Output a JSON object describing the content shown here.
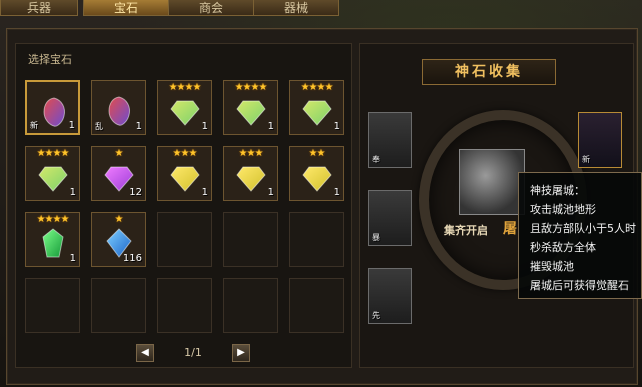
{
  "tabs": [
    {
      "label": "兵器",
      "active": false
    },
    {
      "label": "宝石",
      "active": true
    },
    {
      "label": "商会",
      "active": false
    },
    {
      "label": "器械",
      "active": false
    }
  ],
  "gems_panel": {
    "title": "选择宝石",
    "items": [
      {
        "stars": "",
        "count": "1",
        "tag": "新",
        "kind": "rainbow"
      },
      {
        "stars": "",
        "count": "1",
        "tag": "乱",
        "kind": "rainbow"
      },
      {
        "stars": "★★★★",
        "count": "1",
        "tag": "",
        "kind": "green-yellow"
      },
      {
        "stars": "★★★★",
        "count": "1",
        "tag": "",
        "kind": "green-yellow"
      },
      {
        "stars": "★★★★",
        "count": "1",
        "tag": "",
        "kind": "green-yellow"
      },
      {
        "stars": "★★★★",
        "count": "1",
        "tag": "",
        "kind": "green-yellow"
      },
      {
        "stars": "★",
        "count": "12",
        "tag": "",
        "kind": "purple-crystal"
      },
      {
        "stars": "★★★",
        "count": "1",
        "tag": "",
        "kind": "yellow-crystal"
      },
      {
        "stars": "★★★",
        "count": "1",
        "tag": "",
        "kind": "yellow-crystal"
      },
      {
        "stars": "★★",
        "count": "1",
        "tag": "",
        "kind": "yellow-crystal"
      },
      {
        "stars": "★★★★",
        "count": "1",
        "tag": "",
        "kind": "green-emerald"
      },
      {
        "stars": "★",
        "count": "116",
        "tag": "",
        "kind": "blue-diamond"
      }
    ],
    "pager": {
      "text": "1/1",
      "prev": "◀",
      "next": "▶"
    }
  },
  "collection": {
    "title": "神石收集",
    "slots": [
      {
        "tag": "奉",
        "style": "gray"
      },
      {
        "tag": "暴",
        "style": "gray"
      },
      {
        "tag": "先",
        "style": "gray"
      },
      {
        "tag": "新",
        "style": "gold"
      }
    ],
    "hero_label": "集齐开启",
    "hero_label_suffix": "屠"
  },
  "tooltip": {
    "lines": [
      "神技屠城：",
      "攻击城池地形",
      "且敌方部队小于5人时",
      "秒杀敌方全体",
      "摧毁城池",
      "屠城后可获得觉醒石"
    ]
  },
  "colors": {
    "gold": "#c89a3a",
    "star": "#ffc42a",
    "panel_border": "#57462e"
  }
}
